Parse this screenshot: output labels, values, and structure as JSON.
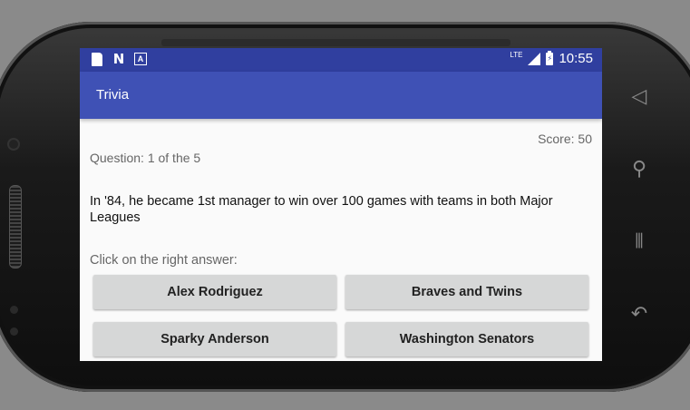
{
  "status_bar": {
    "network": "LTE",
    "time": "10:55"
  },
  "app_bar": {
    "title": "Trivia"
  },
  "quiz": {
    "score_label": "Score: 50",
    "progress_label": "Question: 1 of the 5",
    "question": "In '84, he became 1st manager to win over 100 games with teams in both Major Leagues",
    "prompt": "Click on the right answer:",
    "answers": [
      "Alex Rodriguez",
      "Braves and Twins",
      "Sparky Anderson",
      "Washington Senators"
    ]
  },
  "colors": {
    "status_bar": "#303f9f",
    "app_bar": "#3f51b5",
    "button": "#d6d7d7"
  }
}
